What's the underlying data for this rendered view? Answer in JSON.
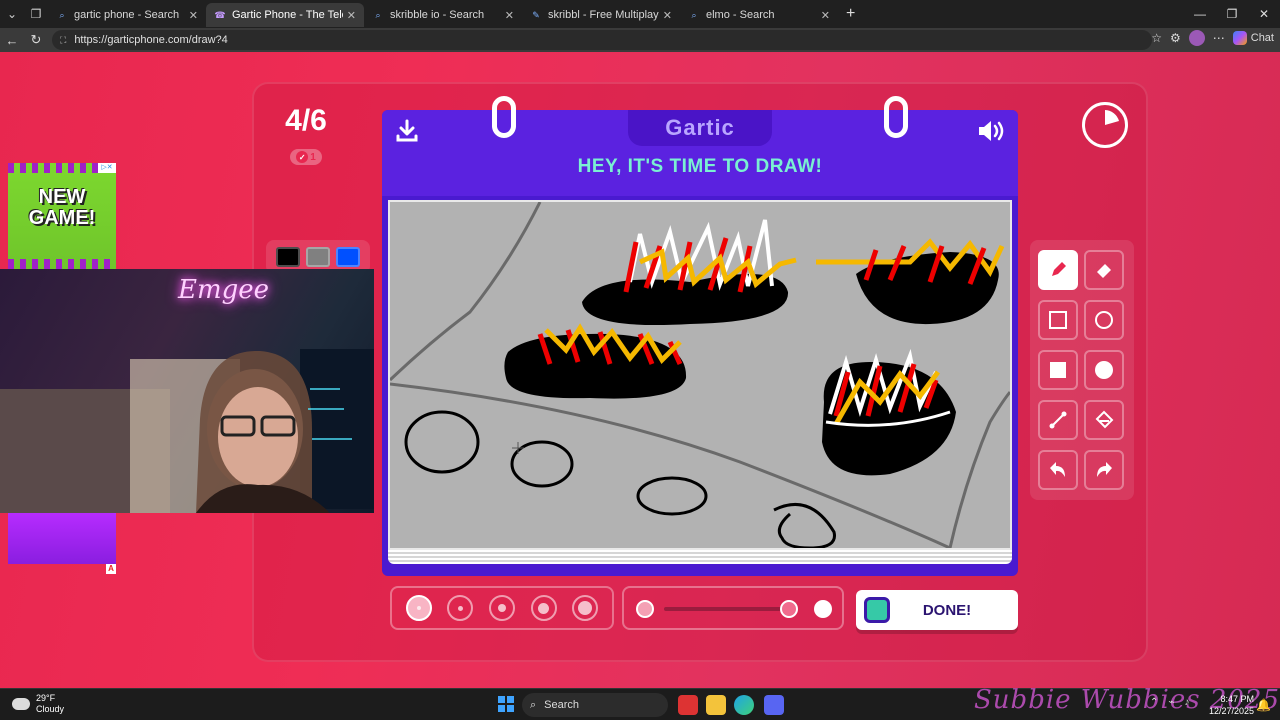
{
  "browser": {
    "tabs": [
      {
        "title": "gartic phone - Search",
        "active": false
      },
      {
        "title": "Gartic Phone - The Telephone Gam",
        "active": true
      },
      {
        "title": "skribble io - Search",
        "active": false
      },
      {
        "title": "skribbl - Free Multiplayer Drawing",
        "active": false
      },
      {
        "title": "elmo - Search",
        "active": false
      }
    ],
    "url": "https://garticphone.com/draw?4",
    "chat_label": "Chat"
  },
  "game": {
    "round": "4/6",
    "done_count": "1",
    "logo": "Gartic",
    "prompt": "HEY, IT'S TIME TO DRAW!",
    "done_label": "DONE!",
    "palette_colors": [
      "#000000",
      "#808080",
      "#0050ff"
    ],
    "tools": [
      "pencil-icon",
      "eraser-icon",
      "rectangle-outline-icon",
      "circle-outline-icon",
      "rectangle-filled-icon",
      "circle-filled-icon",
      "line-icon",
      "fill-bucket-icon",
      "undo-icon",
      "redo-icon"
    ],
    "brush_sizes": [
      "1",
      "2",
      "3",
      "4",
      "5"
    ],
    "selected_brush_size": "1",
    "opacity_level": 0.95
  },
  "overlays": {
    "ad_text": "NEW GAME!",
    "webcam_neon": "Emgee",
    "watermark": "Subbie Wubbies 2025"
  },
  "taskbar": {
    "weather_temp": "29°F",
    "weather_desc": "Cloudy",
    "search_label": "Search",
    "time": "8:47 PM",
    "date": "12/27/2025"
  }
}
